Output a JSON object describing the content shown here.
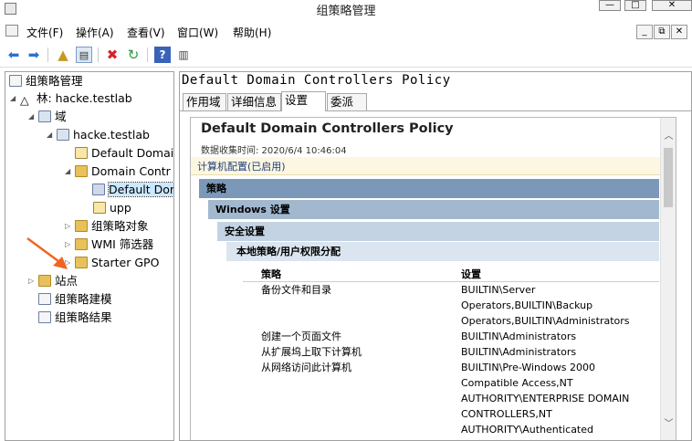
{
  "window": {
    "title": "组策略管理"
  },
  "menu": [
    "文件(F)",
    "操作(A)",
    "查看(V)",
    "窗口(W)",
    "帮助(H)"
  ],
  "tree": {
    "root": "组策略管理",
    "forest": "林: hacke.testlab",
    "domains": "域",
    "domain": "hacke.testlab",
    "default_domain_policy": "Default Domai",
    "domain_controllers": "Domain Contr",
    "selected_policy": "Default Dor",
    "upp": "upp",
    "gpo_objects": "组策略对象",
    "wmi_filters": "WMI 筛选器",
    "starter_gpo": "Starter GPO",
    "sites": "站点",
    "gp_modeling": "组策略建模",
    "gp_results": "组策略结果"
  },
  "right": {
    "heading": "Default Domain Controllers Policy",
    "tabs": [
      "作用域",
      "详细信息",
      "设置",
      "委派"
    ],
    "active_tab": 2
  },
  "report": {
    "title": "Default Domain Controllers Policy",
    "collected": "数据收集时间: 2020/6/4 10:46:04",
    "computer_config": "计算机配置(已启用)",
    "policies": "策略",
    "windows_settings": "Windows 设置",
    "security_settings": "安全设置",
    "local_policy": "本地策略/用户权限分配",
    "col_policy": "策略",
    "col_setting": "设置",
    "rows": [
      {
        "policy": "备份文件和目录",
        "setting": [
          "BUILTIN\\Server",
          "Operators,BUILTIN\\Backup",
          "Operators,BUILTIN\\Administrators"
        ]
      },
      {
        "policy": "创建一个页面文件",
        "setting": [
          "BUILTIN\\Administrators"
        ]
      },
      {
        "policy": "从扩展坞上取下计算机",
        "setting": [
          "BUILTIN\\Administrators"
        ]
      },
      {
        "policy": "从网络访问此计算机",
        "setting": [
          "BUILTIN\\Pre-Windows 2000",
          "Compatible Access,NT",
          "AUTHORITY\\ENTERPRISE DOMAIN",
          "CONTROLLERS,NT",
          "AUTHORITY\\Authenticated"
        ]
      }
    ]
  },
  "colors": {
    "accent_arrow": "#f06522",
    "band_dark": "#7b98b8"
  }
}
